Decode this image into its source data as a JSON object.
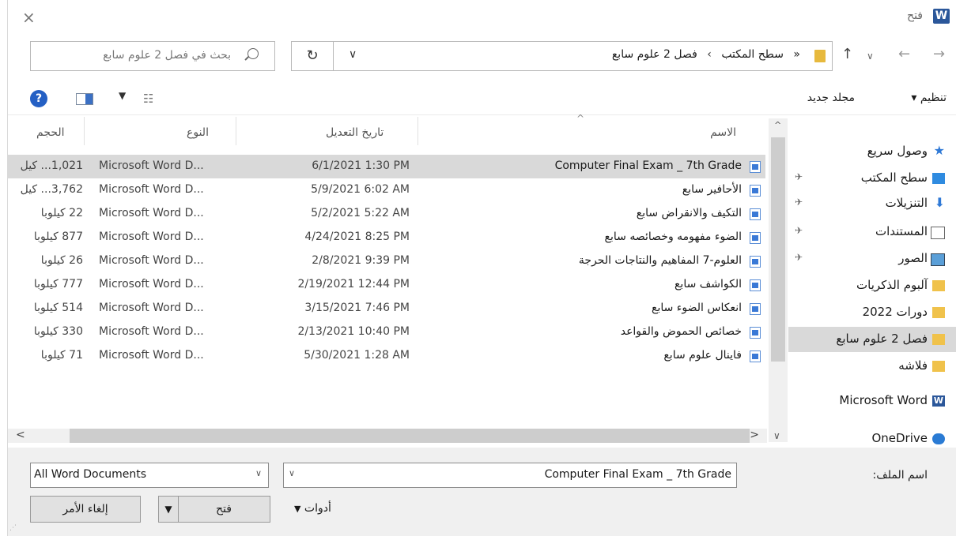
{
  "window": {
    "title": "فتح",
    "close_glyph": "×",
    "app_icon": "word-icon"
  },
  "address": {
    "breadcrumbs": [
      "سطح المكتب",
      "فصل 2 علوم سابع"
    ],
    "overflow": "«",
    "separator": "›"
  },
  "search": {
    "placeholder": "بحث في فصل 2 علوم سابع"
  },
  "toolbar": {
    "organize": "تنظيم ▾",
    "new_folder": "مجلد جديد"
  },
  "columns": {
    "name": "الاسم",
    "date": "تاريخ التعديل",
    "type": "النوع",
    "size": "الحجم"
  },
  "files": [
    {
      "name": "Computer Final Exam _ 7th Grade",
      "date": "6/1/2021 1:30 PM",
      "type": "Microsoft Word D...",
      "size": "1,021... كيل",
      "selected": true
    },
    {
      "name": "الأحافير سابع",
      "date": "5/9/2021 6:02 AM",
      "type": "Microsoft Word D...",
      "size": "3,762... كيل",
      "selected": false
    },
    {
      "name": "التكيف والانقراض سابع",
      "date": "5/2/2021 5:22 AM",
      "type": "Microsoft Word D...",
      "size": "22 كيلوبا",
      "selected": false
    },
    {
      "name": "الضوء مفهومه وخصائصه سابع",
      "date": "4/24/2021 8:25 PM",
      "type": "Microsoft Word D...",
      "size": "877 كيلوبا",
      "selected": false
    },
    {
      "name": "العلوم-7 المفاهيم والنتاجات الحرجة",
      "date": "2/8/2021 9:39 PM",
      "type": "Microsoft Word D...",
      "size": "26 كيلوبا",
      "selected": false
    },
    {
      "name": "الكواشف سابع",
      "date": "2/19/2021 12:44 PM",
      "type": "Microsoft Word D...",
      "size": "777 كيلوبا",
      "selected": false
    },
    {
      "name": "انعكاس الضوء سابع",
      "date": "3/15/2021 7:46 PM",
      "type": "Microsoft Word D...",
      "size": "514 كيلوبا",
      "selected": false
    },
    {
      "name": "خصائص الحموض والقواعد",
      "date": "2/13/2021 10:40 PM",
      "type": "Microsoft Word D...",
      "size": "330 كيلوبا",
      "selected": false
    },
    {
      "name": "فاينال علوم سابع",
      "date": "5/30/2021 1:28 AM",
      "type": "Microsoft Word D...",
      "size": "71 كيلوبا",
      "selected": false
    }
  ],
  "nav": [
    {
      "label": "وصول سريع",
      "icon": "star-icon",
      "pinned": false,
      "selected": false
    },
    {
      "label": "سطح المكتب",
      "icon": "desktop-icon",
      "pinned": true,
      "selected": false
    },
    {
      "label": "التنزيلات",
      "icon": "download-icon",
      "pinned": true,
      "selected": false
    },
    {
      "label": "المستندات",
      "icon": "documents-icon",
      "pinned": true,
      "selected": false
    },
    {
      "label": "الصور",
      "icon": "pictures-icon",
      "pinned": true,
      "selected": false
    },
    {
      "label": "آلبوم الذكريات",
      "icon": "folder-icon",
      "pinned": false,
      "selected": false
    },
    {
      "label": "دورات 2022",
      "icon": "folder-icon",
      "pinned": false,
      "selected": false
    },
    {
      "label": "فصل 2 علوم سابع",
      "icon": "folder-icon",
      "pinned": false,
      "selected": true
    },
    {
      "label": "فلاشه",
      "icon": "folder-icon",
      "pinned": false,
      "selected": false
    },
    {
      "label": "Microsoft Word",
      "icon": "word-icon",
      "pinned": false,
      "selected": false
    },
    {
      "label": "OneDrive",
      "icon": "onedrive-icon",
      "pinned": false,
      "selected": false
    }
  ],
  "bottom": {
    "filename_label": "اسم الملف:",
    "filename_value": "Computer Final Exam _ 7th Grade",
    "filter_value": "All Word Documents",
    "tools": "أدوات",
    "open": "فتح",
    "cancel": "إلغاء الأمر"
  },
  "colors": {
    "accent": "#2b579a",
    "selection": "#d9d9d9",
    "folder": "#f0c24b"
  }
}
